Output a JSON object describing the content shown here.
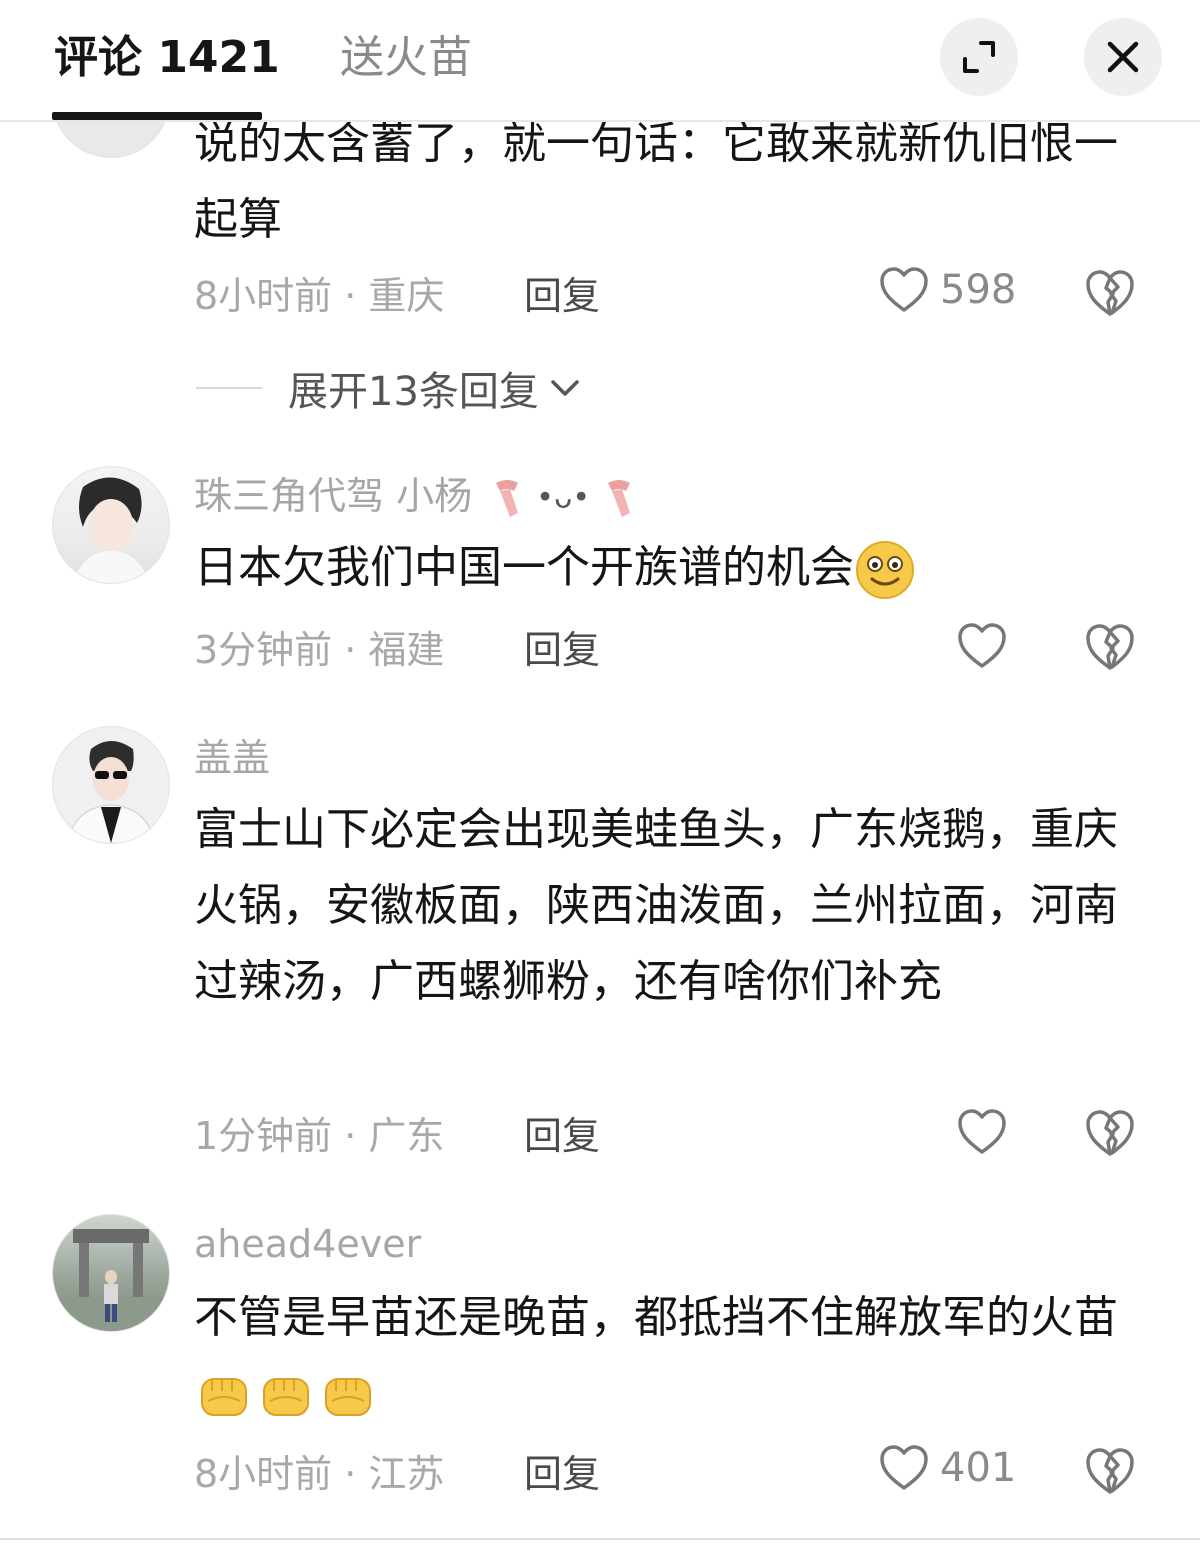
{
  "header": {
    "tab_comments": "评论 1421",
    "tab_fire": "送火苗",
    "expand_icon": "expand-icon",
    "close_icon": "close-icon"
  },
  "comments": [
    {
      "text": "说的太含蓄了，就一句话：它敢来就新仇旧恨一起算",
      "time_location": "8小时前 · 重庆",
      "reply": "回复",
      "likes": "598",
      "expand_replies": "展开13条回复"
    },
    {
      "username": "珠三角代驾 小杨",
      "text": "日本欠我们中国一个开族谱的机会",
      "time_location": "3分钟前 · 福建",
      "reply": "回复"
    },
    {
      "username": "盖盖",
      "text": "富士山下必定会出现美蛙鱼头，广东烧鹅，重庆火锅，安徽板面，陕西油泼面，兰州拉面，河南过辣汤，广西螺狮粉，还有啥你们补充",
      "time_location": "1分钟前 · 广东",
      "reply": "回复"
    },
    {
      "username": "ahead4ever",
      "text": "不管是早苗还是晚苗，都抵挡不住解放军的火苗",
      "time_location": "8小时前 · 江苏",
      "reply": "回复",
      "likes": "401"
    }
  ],
  "colors": {
    "accent": "#161616",
    "muted": "#a8a8a8",
    "emoji": "#f7c948"
  }
}
